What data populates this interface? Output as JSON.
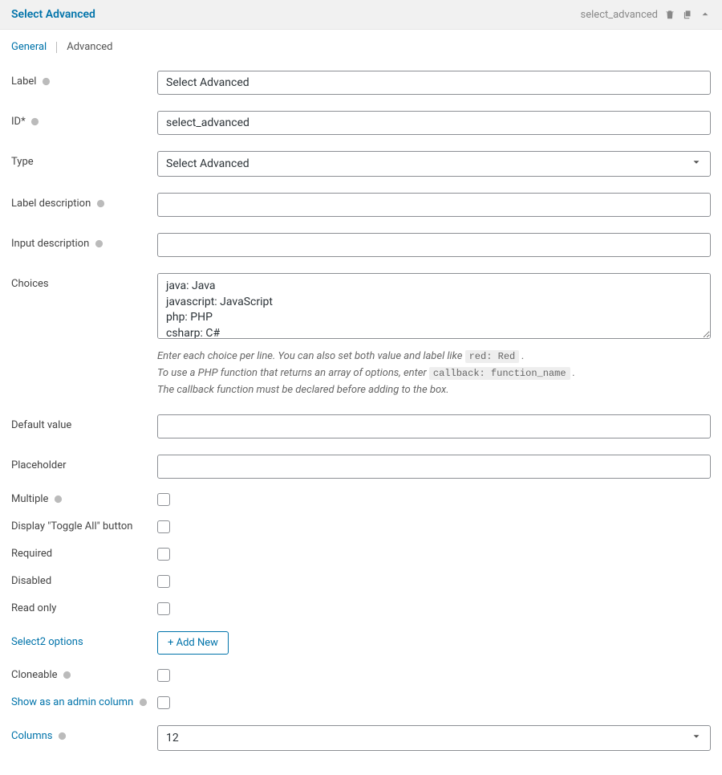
{
  "header": {
    "title": "Select Advanced",
    "slug": "select_advanced"
  },
  "tabs": {
    "general": "General",
    "advanced": "Advanced",
    "active": "general"
  },
  "fields": {
    "label": {
      "label": "Label",
      "value": "Select Advanced",
      "help": true
    },
    "id": {
      "label": "ID*",
      "value": "select_advanced",
      "help": true
    },
    "type": {
      "label": "Type",
      "value": "Select Advanced"
    },
    "label_description": {
      "label": "Label description",
      "value": "",
      "help": true
    },
    "input_description": {
      "label": "Input description",
      "value": "",
      "help": true
    },
    "choices": {
      "label": "Choices",
      "value": "java: Java\njavascript: JavaScript\nphp: PHP\ncsharp: C#",
      "hint1_pre": "Enter each choice per line. You can also set both value and label like ",
      "hint1_code": "red: Red",
      "hint1_post": " .",
      "hint2_pre": "To use a PHP function that returns an array of options, enter ",
      "hint2_code": "callback: function_name",
      "hint2_post": " .",
      "hint3": "The callback function must be declared before adding to the box."
    },
    "default_value": {
      "label": "Default value",
      "value": ""
    },
    "placeholder": {
      "label": "Placeholder",
      "value": ""
    },
    "multiple": {
      "label": "Multiple",
      "help": true
    },
    "toggle_all": {
      "label": "Display \"Toggle All\" button"
    },
    "required": {
      "label": "Required"
    },
    "disabled": {
      "label": "Disabled"
    },
    "readonly": {
      "label": "Read only"
    },
    "select2_options": {
      "label": "Select2 options",
      "button": "+ Add New"
    },
    "cloneable": {
      "label": "Cloneable",
      "help": true
    },
    "admin_column": {
      "label": "Show as an admin column",
      "help": true
    },
    "columns": {
      "label": "Columns",
      "value": "12",
      "help": true
    }
  }
}
